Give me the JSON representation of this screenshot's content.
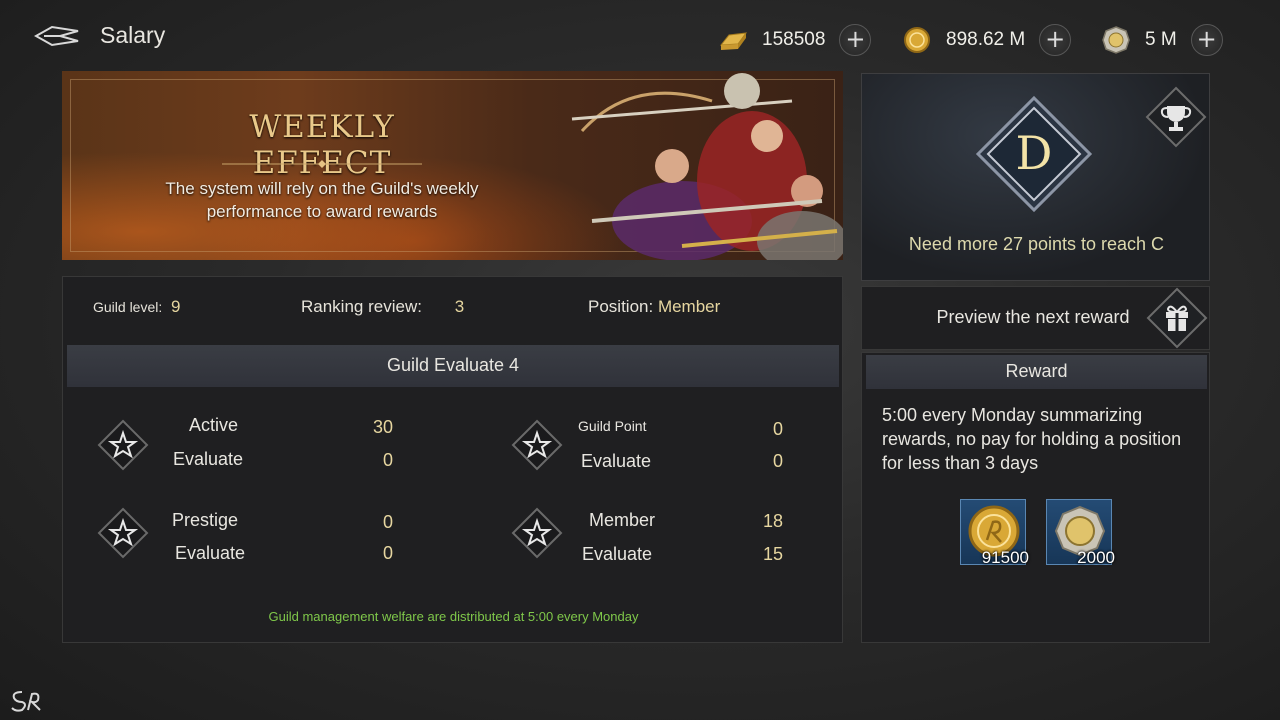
{
  "header": {
    "title": "Salary"
  },
  "currencies": [
    {
      "icon": "gold-bar-icon",
      "amount": "158508"
    },
    {
      "icon": "gold-coin-icon",
      "amount": "898.62 M"
    },
    {
      "icon": "silver-coin-icon",
      "amount": "5 M"
    }
  ],
  "banner": {
    "title": "WEEKLY EFFECT",
    "description": "The system will rely on the Guild's weekly performance to award rewards"
  },
  "rank": {
    "grade": "D",
    "progress_text": "Need more 27 points to reach C"
  },
  "guild_info": {
    "level_label": "Guild level:",
    "level_value": "9",
    "ranking_label": "Ranking review:",
    "ranking_value": "3",
    "position_label": "Position:",
    "position_value": "Member"
  },
  "evaluate": {
    "title": "Guild Evaluate 4",
    "metrics": [
      {
        "label": "Active",
        "value": "30",
        "eval_label": "Evaluate",
        "eval_value": "0"
      },
      {
        "label": "Guild Point",
        "value": "0",
        "eval_label": "Evaluate",
        "eval_value": "0"
      },
      {
        "label": "Prestige",
        "value": "0",
        "eval_label": "Evaluate",
        "eval_value": "0"
      },
      {
        "label": "Member",
        "value": "18",
        "eval_label": "Evaluate",
        "eval_value": "15"
      }
    ],
    "footer_note": "Guild management welfare are distributed at 5:00 every Monday"
  },
  "preview": {
    "label": "Preview the next reward"
  },
  "reward": {
    "title": "Reward",
    "description": "5:00 every Monday summarizing rewards, no pay for holding a position for less than 3 days",
    "items": [
      {
        "icon": "gold-coin-icon",
        "qty": "91500"
      },
      {
        "icon": "silver-coin-icon",
        "qty": "2000"
      }
    ]
  },
  "colors": {
    "accent_gold": "#e6d6a0",
    "banner_title": "#e9c98a",
    "footer_green": "#7fc84a",
    "reward_item_bg": "#1f4469"
  }
}
